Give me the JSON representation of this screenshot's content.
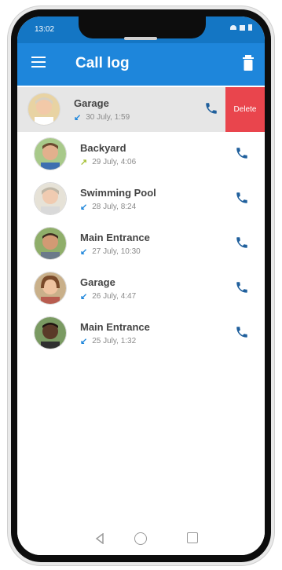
{
  "status_bar": {
    "time": "13:02"
  },
  "app_bar": {
    "title": "Call log",
    "menu_icon": "menu-icon",
    "trash_icon": "trash-icon"
  },
  "accent_color": "#1e86db",
  "delete_color": "#e9454d",
  "calls": [
    {
      "name": "Garage",
      "date": "30 July, 1:59",
      "direction": "incoming",
      "swiped": true
    },
    {
      "name": "Backyard",
      "date": "29 July, 4:06",
      "direction": "outgoing",
      "swiped": false
    },
    {
      "name": "Swimming Pool",
      "date": "28 July, 8:24",
      "direction": "incoming",
      "swiped": false
    },
    {
      "name": "Main Entrance",
      "date": "27 July, 10:30",
      "direction": "incoming",
      "swiped": false
    },
    {
      "name": "Garage",
      "date": "26 July, 4:47",
      "direction": "incoming",
      "swiped": false
    },
    {
      "name": "Main Entrance",
      "date": "25 July, 1:32",
      "direction": "incoming",
      "swiped": false
    }
  ],
  "swipe_action": {
    "label": "Delete"
  },
  "nav_bar": {
    "back_icon": "back-triangle-icon",
    "home_icon": "home-circle-icon",
    "recent_icon": "recent-square-icon"
  }
}
